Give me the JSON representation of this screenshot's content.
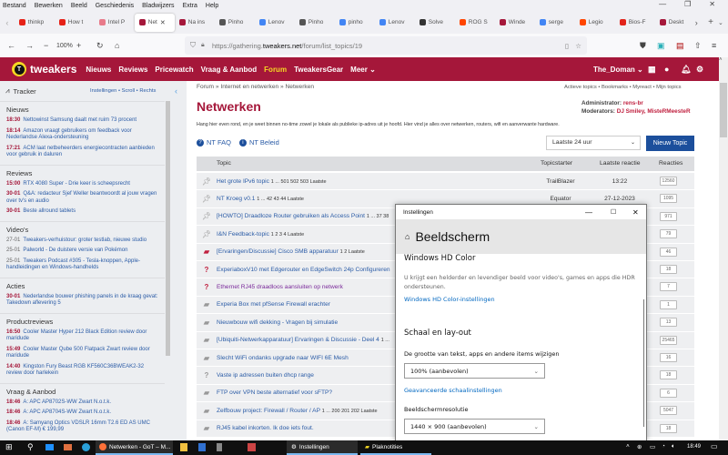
{
  "browser": {
    "menu": [
      "Bestand",
      "Bewerken",
      "Beeld",
      "Geschiedenis",
      "Bladwijzers",
      "Extra",
      "Help"
    ],
    "tabs": [
      {
        "label": "thinkp",
        "color": "#e62117"
      },
      {
        "label": "How t",
        "color": "#e62117"
      },
      {
        "label": "Intel P",
        "color": "#e87a8a"
      },
      {
        "label": "Net",
        "color": "#a5173a",
        "active": true
      },
      {
        "label": "Na ins",
        "color": "#a5173a"
      },
      {
        "label": "Pinho",
        "color": "#555"
      },
      {
        "label": "Lenov",
        "color": "#4285f4"
      },
      {
        "label": "Pinho",
        "color": "#555"
      },
      {
        "label": "pinho",
        "color": "#4285f4"
      },
      {
        "label": "Lenov",
        "color": "#4285f4"
      },
      {
        "label": "Solve",
        "color": "#333"
      },
      {
        "label": "ROG S",
        "color": "#ff4500"
      },
      {
        "label": "Winde",
        "color": "#a5173a"
      },
      {
        "label": "serge",
        "color": "#4285f4"
      },
      {
        "label": "Legio",
        "color": "#ff4500"
      },
      {
        "label": "Bios-F",
        "color": "#e2231a"
      },
      {
        "label": "Deskt",
        "color": "#a5173a"
      }
    ],
    "zoom": "100%",
    "url_prefix": "https://gathering.",
    "url_domain": "tweakers.net",
    "url_path": "/forum/list_topics/19"
  },
  "site": {
    "logo": "tweakers",
    "nav": [
      "Nieuws",
      "Reviews",
      "Pricewatch",
      "Vraag & Aanbod",
      "Forum",
      "TweakersGear",
      "Meer ⌄"
    ],
    "active_color": "#f5d823",
    "user": "The_Doman ⌄",
    "brand_color": "#a5173a"
  },
  "tracker": {
    "title": "Tracker",
    "links": "Instellingen • Scroll • Rechts",
    "sections": [
      {
        "name": "Nieuws",
        "items": [
          {
            "time": "18:30",
            "text": "Nettowinst Samsung daalt met ruim 73 procent"
          },
          {
            "time": "18:14",
            "text": "Amazon vraagt gebruikers om feedback voor Nederlandse Alexa-ondersteuning"
          },
          {
            "time": "17:21",
            "text": "ACM laat netbeheerders energiecontracten aanbieden voor gebruik in daluren"
          }
        ]
      },
      {
        "name": "Reviews",
        "items": [
          {
            "time": "15:00",
            "text": "RTX 4080 Super - Drie keer is scheepsrecht"
          },
          {
            "time": "30-01",
            "text": "Q&A: redacteur Sjef Weller beantwoordt al jouw vragen over tv's en audio"
          },
          {
            "time": "30-01",
            "text": "Beste allround tablets"
          }
        ]
      },
      {
        "name": "Video's",
        "grey": true,
        "items": [
          {
            "time": "27-01",
            "text": "Tweakers-verhuistour: groter testlab, nieuwe studio"
          },
          {
            "time": "25-01",
            "text": "Palworld - De duistere versie van Pokémon"
          },
          {
            "time": "25-01",
            "text": "Tweakers Podcast #305 - Tesla-knoppen, Apple-handleidingen en Windows-handhelds"
          }
        ]
      },
      {
        "name": "Acties",
        "items": [
          {
            "time": "30-01",
            "text": "Nederlandse bouwer phishing panels in de kraag gevat: Takedown aflevering 5"
          }
        ]
      },
      {
        "name": "Productreviews",
        "items": [
          {
            "time": "16:50",
            "text": "Cooler Master Hyper 212 Black Edition review door maridude"
          },
          {
            "time": "15:49",
            "text": "Cooler Master Qube 500 Flatpack Zwart review door maridude"
          },
          {
            "time": "14:40",
            "text": "Kingston Fury Beast RGB KF560C36BWEAK2-32 review door harlekein"
          }
        ]
      },
      {
        "name": "Vraag & Aanbod",
        "items": [
          {
            "time": "18:46",
            "text": "A: APC AP8702S-WW Zwart N.o.t.k."
          },
          {
            "time": "18:46",
            "text": "A: APC AP8704S-WW Zwart N.o.t.k."
          },
          {
            "time": "18:46",
            "text": "A: Samyang Optics VDSLR 16mm T2.6 ED AS UMC (Canon EF-M) € 199,99"
          }
        ]
      }
    ]
  },
  "forum": {
    "breadcrumb": [
      "Forum",
      "Internet en netwerken",
      "Netwerken"
    ],
    "quicklinks": "Actieve topics • Bookmarks • Myreact • Mijn topics",
    "title": "Netwerken",
    "admin_label": "Administrator:",
    "admin": "rens-br",
    "mod_label": "Moderators:",
    "mods": "DJ Smiley, MisteRMeesteR",
    "description": "Hang hier even rond, en je weet binnen no-time zowel je lokale als publieke ip-adres uit je hoofd. Hier vind je alles over netwerken, routers, wifi en aanverwante hardware.",
    "faq": "NT FAQ",
    "beleid": "NT Beleid",
    "filter": "Laatste 24 uur",
    "new_topic": "Nieuw Topic",
    "columns": [
      "Topic",
      "Topicstarter",
      "Laatste reactie",
      "Reacties"
    ],
    "rows": [
      {
        "icon": "pin",
        "title": "Het grote IPv6 topic",
        "pages": "1 ... 501 502 503 Laatste",
        "starter": "TrailBlazer",
        "last": "13:22",
        "replies": "12560"
      },
      {
        "icon": "pin",
        "title": "NT Kroeg v0.1",
        "pages": "1 ... 42 43 44 Laatste",
        "starter": "Equator",
        "last": "27-12-2023",
        "replies": "1095"
      },
      {
        "icon": "pin",
        "title": "[HOWTO] Draadloze Router gebruiken als Access Point",
        "pages": "1 ... 37 38",
        "replies": "971"
      },
      {
        "icon": "pin",
        "title": "I&N Feedback-topic",
        "pages": "1 2 3 4 Laatste",
        "replies": "79"
      },
      {
        "icon": "hot",
        "title": "[Ervaringen/Discussie] Cisco SMB apparatuur",
        "pages": "1 2 Laatste",
        "replies": "46"
      },
      {
        "icon": "question-red",
        "title": "ExperiaboxV10 met Edgerouter en EdgeSwitch 24p Configureren",
        "pages": "",
        "replies": "18"
      },
      {
        "icon": "question-red",
        "title": "Ethernet RJ45 draadloos aansluiten op netwerk",
        "pages": "",
        "visited": true,
        "replies": "7"
      },
      {
        "icon": "chat",
        "title": "Experia Box met pfSense Firewall erachter",
        "pages": "",
        "replies": "1"
      },
      {
        "icon": "chat",
        "title": "Nieuwbouw wifi dekking - Vragen bij simulatie",
        "pages": "",
        "replies": "13"
      },
      {
        "icon": "chat",
        "title": "[Ubiquiti-Netwerkapparatuur] Ervaringen & Discussie - Deel 4",
        "pages": "1 ...",
        "replies": "25465"
      },
      {
        "icon": "chat",
        "title": "Slecht WiFi ondanks upgrade naar WIFI 6E Mesh",
        "pages": "",
        "replies": "16"
      },
      {
        "icon": "question",
        "title": "Vaste ip adressen buiten dhcp range",
        "pages": "",
        "replies": "18"
      },
      {
        "icon": "chat",
        "title": "FTP over VPN beste alternatief voor sFTP?",
        "pages": "",
        "replies": "6"
      },
      {
        "icon": "chat",
        "title": "Zelfbouw project: Firewall / Router / AP",
        "pages": "1 ... 200 201 202 Laatste",
        "replies": "5047"
      },
      {
        "icon": "chat",
        "title": "RJ45 kabel inkorten. Ik doe iets fout.",
        "pages": "",
        "replies": "18"
      }
    ]
  },
  "settings": {
    "window_title": "Instellingen",
    "page": "Beeldscherm",
    "hd_title": "Windows HD Color",
    "hd_desc": "U krijgt een helderder en levendiger beeld voor video's, games en apps die HDR ondersteunen.",
    "hd_link": "Windows HD Color-instellingen",
    "scale_title": "Schaal en lay-out",
    "scale_label": "De grootte van tekst, apps en andere items wijzigen",
    "scale_value": "100% (aanbevolen)",
    "scale_link": "Geavanceerde schaalinstellingen",
    "res_label": "Beeldschermresolutie",
    "res_value": "1440 × 900 (aanbevolen)"
  },
  "taskbar": {
    "apps": [
      {
        "label": "Netwerken - GoT – M..."
      },
      {
        "label": "Instellingen"
      },
      {
        "label": "Plaknotities"
      }
    ],
    "time": "18:49"
  }
}
